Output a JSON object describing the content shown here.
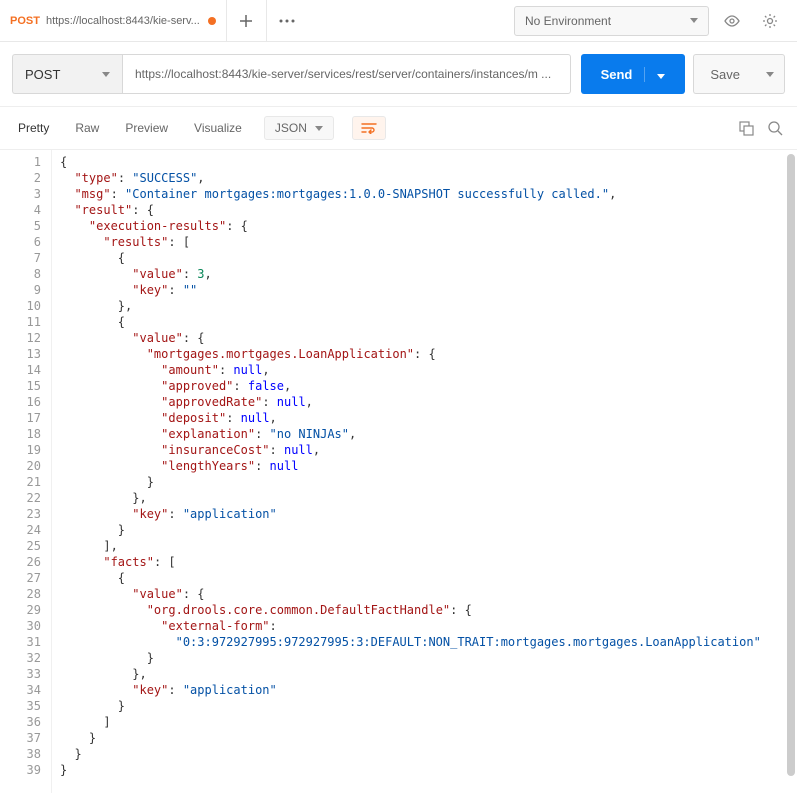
{
  "top": {
    "tab_method": "POST",
    "tab_title": "https://localhost:8443/kie-serv...",
    "env_label": "No Environment"
  },
  "request": {
    "method": "POST",
    "url": "https://localhost:8443/kie-server/services/rest/server/containers/instances/m ...",
    "send": "Send",
    "save": "Save"
  },
  "response_tabs": {
    "pretty": "Pretty",
    "raw": "Raw",
    "preview": "Preview",
    "visualize": "Visualize",
    "format": "JSON"
  },
  "code_lines": [
    [
      [
        "p",
        "{"
      ]
    ],
    [
      [
        "p",
        "  "
      ],
      [
        "k",
        "\"type\""
      ],
      [
        "p",
        ": "
      ],
      [
        "s",
        "\"SUCCESS\""
      ],
      [
        "p",
        ","
      ]
    ],
    [
      [
        "p",
        "  "
      ],
      [
        "k",
        "\"msg\""
      ],
      [
        "p",
        ": "
      ],
      [
        "s",
        "\"Container mortgages:mortgages:1.0.0-SNAPSHOT successfully called.\""
      ],
      [
        "p",
        ","
      ]
    ],
    [
      [
        "p",
        "  "
      ],
      [
        "k",
        "\"result\""
      ],
      [
        "p",
        ": {"
      ]
    ],
    [
      [
        "p",
        "    "
      ],
      [
        "k",
        "\"execution-results\""
      ],
      [
        "p",
        ": {"
      ]
    ],
    [
      [
        "p",
        "      "
      ],
      [
        "k",
        "\"results\""
      ],
      [
        "p",
        ": ["
      ]
    ],
    [
      [
        "p",
        "        {"
      ]
    ],
    [
      [
        "p",
        "          "
      ],
      [
        "k",
        "\"value\""
      ],
      [
        "p",
        ": "
      ],
      [
        "n",
        "3"
      ],
      [
        "p",
        ","
      ]
    ],
    [
      [
        "p",
        "          "
      ],
      [
        "k",
        "\"key\""
      ],
      [
        "p",
        ": "
      ],
      [
        "s",
        "\"\""
      ]
    ],
    [
      [
        "p",
        "        },"
      ]
    ],
    [
      [
        "p",
        "        {"
      ]
    ],
    [
      [
        "p",
        "          "
      ],
      [
        "k",
        "\"value\""
      ],
      [
        "p",
        ": {"
      ]
    ],
    [
      [
        "p",
        "            "
      ],
      [
        "k",
        "\"mortgages.mortgages.LoanApplication\""
      ],
      [
        "p",
        ": {"
      ]
    ],
    [
      [
        "p",
        "              "
      ],
      [
        "k",
        "\"amount\""
      ],
      [
        "p",
        ": "
      ],
      [
        "nu",
        "null"
      ],
      [
        "p",
        ","
      ]
    ],
    [
      [
        "p",
        "              "
      ],
      [
        "k",
        "\"approved\""
      ],
      [
        "p",
        ": "
      ],
      [
        "b",
        "false"
      ],
      [
        "p",
        ","
      ]
    ],
    [
      [
        "p",
        "              "
      ],
      [
        "k",
        "\"approvedRate\""
      ],
      [
        "p",
        ": "
      ],
      [
        "nu",
        "null"
      ],
      [
        "p",
        ","
      ]
    ],
    [
      [
        "p",
        "              "
      ],
      [
        "k",
        "\"deposit\""
      ],
      [
        "p",
        ": "
      ],
      [
        "nu",
        "null"
      ],
      [
        "p",
        ","
      ]
    ],
    [
      [
        "p",
        "              "
      ],
      [
        "k",
        "\"explanation\""
      ],
      [
        "p",
        ": "
      ],
      [
        "s",
        "\"no NINJAs\""
      ],
      [
        "p",
        ","
      ]
    ],
    [
      [
        "p",
        "              "
      ],
      [
        "k",
        "\"insuranceCost\""
      ],
      [
        "p",
        ": "
      ],
      [
        "nu",
        "null"
      ],
      [
        "p",
        ","
      ]
    ],
    [
      [
        "p",
        "              "
      ],
      [
        "k",
        "\"lengthYears\""
      ],
      [
        "p",
        ": "
      ],
      [
        "nu",
        "null"
      ]
    ],
    [
      [
        "p",
        "            }"
      ]
    ],
    [
      [
        "p",
        "          },"
      ]
    ],
    [
      [
        "p",
        "          "
      ],
      [
        "k",
        "\"key\""
      ],
      [
        "p",
        ": "
      ],
      [
        "s",
        "\"application\""
      ]
    ],
    [
      [
        "p",
        "        }"
      ]
    ],
    [
      [
        "p",
        "      ],"
      ]
    ],
    [
      [
        "p",
        "      "
      ],
      [
        "k",
        "\"facts\""
      ],
      [
        "p",
        ": ["
      ]
    ],
    [
      [
        "p",
        "        {"
      ]
    ],
    [
      [
        "p",
        "          "
      ],
      [
        "k",
        "\"value\""
      ],
      [
        "p",
        ": {"
      ]
    ],
    [
      [
        "p",
        "            "
      ],
      [
        "k",
        "\"org.drools.core.common.DefaultFactHandle\""
      ],
      [
        "p",
        ": {"
      ]
    ],
    [
      [
        "p",
        "              "
      ],
      [
        "k",
        "\"external-form\""
      ],
      [
        "p",
        ":"
      ]
    ],
    [
      [
        "p",
        "                "
      ],
      [
        "s",
        "\"0:3:972927995:972927995:3:DEFAULT:NON_TRAIT:mortgages.mortgages.LoanApplication\""
      ]
    ],
    [
      [
        "p",
        "            }"
      ]
    ],
    [
      [
        "p",
        "          },"
      ]
    ],
    [
      [
        "p",
        "          "
      ],
      [
        "k",
        "\"key\""
      ],
      [
        "p",
        ": "
      ],
      [
        "s",
        "\"application\""
      ]
    ],
    [
      [
        "p",
        "        }"
      ]
    ],
    [
      [
        "p",
        "      ]"
      ]
    ],
    [
      [
        "p",
        "    }"
      ]
    ],
    [
      [
        "p",
        "  }"
      ]
    ],
    [
      [
        "p",
        "}"
      ]
    ]
  ]
}
